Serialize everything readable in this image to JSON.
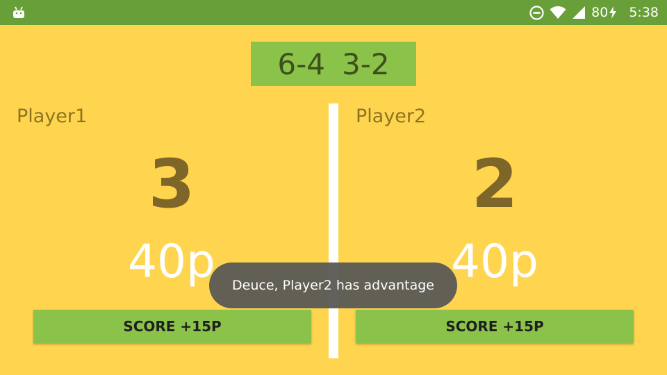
{
  "status_bar": {
    "battery": "80",
    "time": "5:38",
    "icons": [
      "android-icon",
      "do-not-disturb-icon",
      "wifi-icon",
      "cell-signal-icon",
      "battery-charging-icon"
    ]
  },
  "sets": {
    "set1": "6-4",
    "set2": "3-2"
  },
  "player1": {
    "name": "Player1",
    "games": "3",
    "points": "40p",
    "button_label": "SCORE +15P"
  },
  "player2": {
    "name": "Player2",
    "games": "2",
    "points": "40p",
    "button_label": "SCORE +15P"
  },
  "toast": {
    "message": "Deuce, Player2 has advantage"
  },
  "colors": {
    "background": "#FFD54F",
    "status_bar": "#689F38",
    "accent_green": "#8BC34A",
    "divider": "#FFFFFF",
    "toast": "#5A5854"
  }
}
